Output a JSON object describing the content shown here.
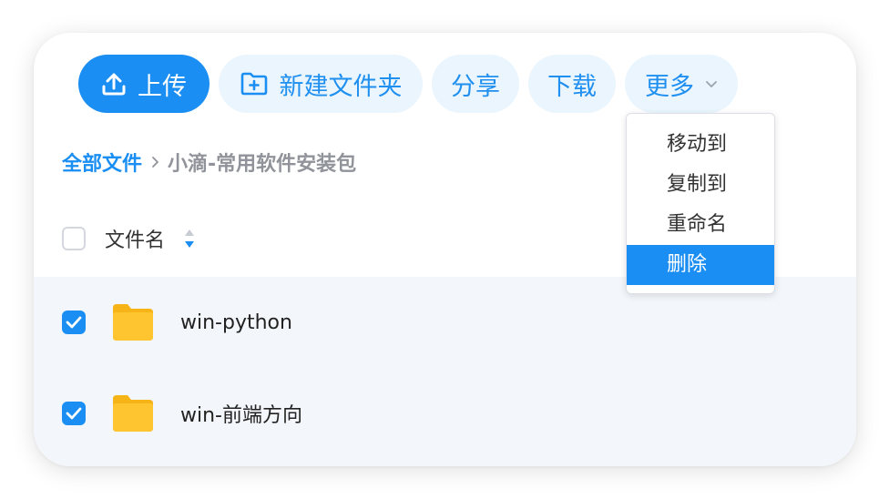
{
  "toolbar": {
    "upload_label": "上传",
    "new_folder_label": "新建文件夹",
    "share_label": "分享",
    "download_label": "下载",
    "more_label": "更多"
  },
  "breadcrumb": {
    "root": "全部文件",
    "current": "小滴-常用软件安装包"
  },
  "table": {
    "name_header": "文件名",
    "rows": [
      {
        "name": "win-python",
        "checked": true
      },
      {
        "name": "win-前端方向",
        "checked": true
      }
    ]
  },
  "dropdown": {
    "items": [
      "移动到",
      "复制到",
      "重命名",
      "删除"
    ],
    "active_index": 3
  },
  "colors": {
    "accent": "#1a8ef2",
    "button_bg": "#eaf5fd",
    "row_bg": "#f3f6fa",
    "folder": "#ffc531"
  },
  "icons": {
    "upload": "upload-icon",
    "new_folder": "folder-plus-icon",
    "more": "chevron-down-icon",
    "breadcrumb_sep": "chevron-right-icon",
    "sort": "sort-icon",
    "folder": "folder-icon",
    "check": "check-icon"
  }
}
